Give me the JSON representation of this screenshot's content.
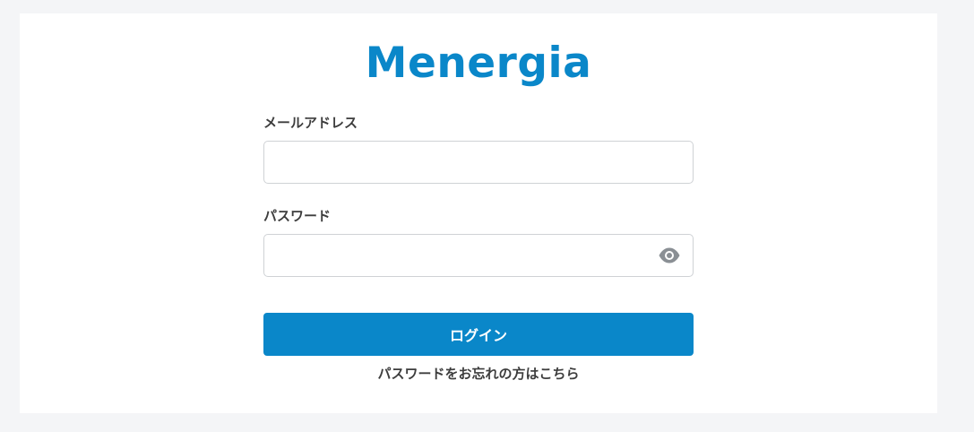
{
  "brand": {
    "logo_text": "Menergia"
  },
  "form": {
    "email_label": "メールアドレス",
    "email_value": "",
    "email_placeholder": "",
    "password_label": "パスワード",
    "password_value": "",
    "password_placeholder": "",
    "login_label": "ログイン",
    "forgot_label": "パスワードをお忘れの方はこちら"
  },
  "icons": {
    "password_toggle": "eye-icon"
  },
  "colors": {
    "page_background": "#f4f5f7",
    "card_background": "#ffffff",
    "brand": "#0a87c9",
    "button": "#0a87c9",
    "label_text": "#3d3d3d",
    "icon": "#8a8f94"
  }
}
